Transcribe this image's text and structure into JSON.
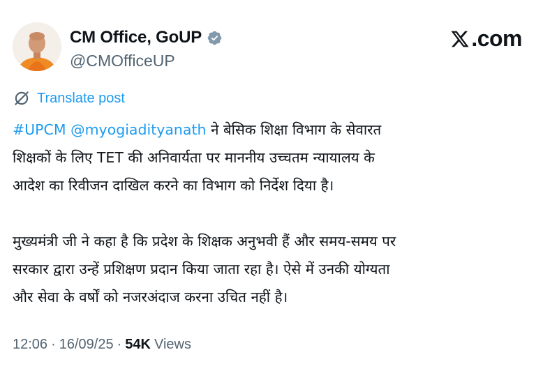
{
  "author": {
    "display_name": "CM Office, GoUP",
    "handle": "@CMOfficeUP",
    "verified": true,
    "verified_color": "#829aab"
  },
  "brand": {
    "text": ".com",
    "icon": "x-logo-icon"
  },
  "translate": {
    "label": "Translate post",
    "icon": "translate-icon"
  },
  "post": {
    "paragraph1": {
      "hashtag": "#UPCM",
      "mention": "@myogiadityanath",
      "line1_rest": "ने बेसिक शिक्षा विभाग के सेवारत",
      "line2": "शिक्षकों के लिए TET की अनिवार्यता पर माननीय उच्चतम न्यायालय के",
      "line3": "आदेश का रिवीजन दाखिल करने का विभाग को निर्देश दिया है।"
    },
    "paragraph2": {
      "line1": "मुख्यमंत्री जी ने कहा है कि प्रदेश के शिक्षक अनुभवी हैं और समय-समय पर",
      "line2": "सरकार द्वारा उन्हें प्रशिक्षण प्रदान किया जाता रहा है। ऐसे में उनकी योग्यता",
      "line3": "और सेवा के वर्षों को नजरअंदाज करना उचित नहीं है।"
    }
  },
  "meta": {
    "time": "12:06",
    "separator": "·",
    "date": "16/09/25",
    "views_count": "54K",
    "views_label": "Views"
  },
  "colors": {
    "link": "#1d9bf0",
    "text": "#0f1419",
    "secondary": "#536471"
  }
}
